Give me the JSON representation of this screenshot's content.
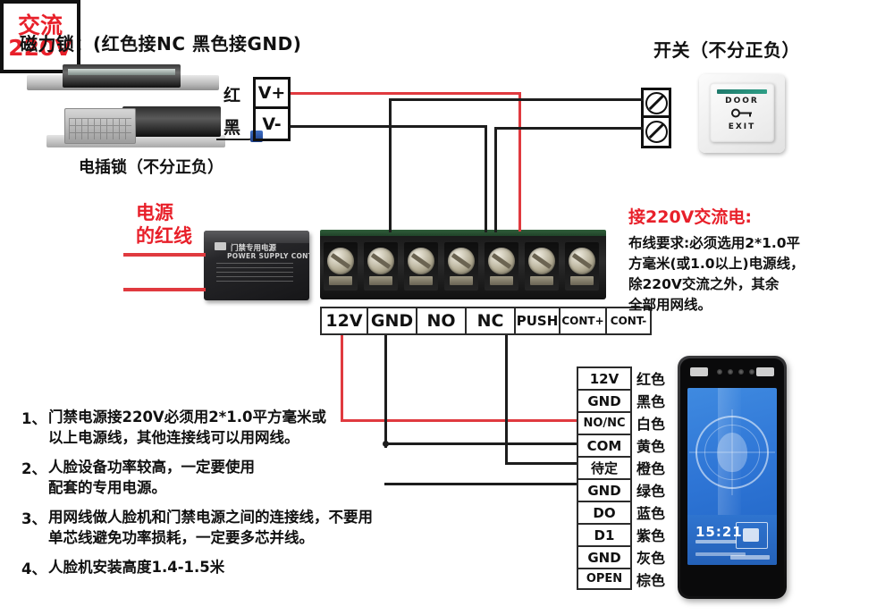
{
  "headings": {
    "mag_lock": "磁力锁：(红色接NC  黑色接GND)",
    "bolt_lock": "电插锁（不分正负）",
    "switch": "开关（不分正负）",
    "power_red_line": "电源\n的红线",
    "ac_label": "交流\n220V"
  },
  "ac_box": {
    "line1": "交流",
    "line2": "220V"
  },
  "psu": {
    "cn": "门禁专用电源",
    "en": "POWER SUPPLY CONTROL"
  },
  "vbox": {
    "red_label": "红",
    "black_label": "黑",
    "vplus": "V+",
    "vminus": "V-"
  },
  "exit_button": {
    "door": "DOOR",
    "exit": "EXIT"
  },
  "terminal_block": {
    "labels": [
      "12V",
      "GND",
      "NO",
      "NC",
      "PUSH",
      "CONT+",
      "CONT-"
    ],
    "widths": [
      52,
      55,
      55,
      55,
      50,
      52,
      52
    ],
    "font_sizes": [
      19,
      19,
      19,
      19,
      15,
      12,
      12
    ]
  },
  "device_terminals": [
    {
      "pin": "12V",
      "color_name": "红色"
    },
    {
      "pin": "GND",
      "color_name": "黑色"
    },
    {
      "pin": "NO/NC",
      "color_name": "白色"
    },
    {
      "pin": "COM",
      "color_name": "黄色"
    },
    {
      "pin": "待定",
      "color_name": "橙色"
    },
    {
      "pin": "GND",
      "color_name": "绿色"
    },
    {
      "pin": "DO",
      "color_name": "蓝色"
    },
    {
      "pin": "D1",
      "color_name": "紫色"
    },
    {
      "pin": "GND",
      "color_name": "灰色"
    },
    {
      "pin": "OPEN",
      "color_name": "棕色"
    }
  ],
  "right_note": {
    "title": "接220V交流电:",
    "lines": [
      "布线要求:必须选用2*1.0平",
      "方毫米(或1.0以上)电源线，",
      "除220V交流之外，其余",
      "全部用网线。"
    ]
  },
  "notes": [
    {
      "num": "1、",
      "lines": [
        "门禁电源接220V必须用2*1.0平方毫米或",
        "以上电源线，其他连接线可以用网线。"
      ]
    },
    {
      "num": "2、",
      "lines": [
        "人脸设备功率较高，一定要使用",
        "配套的专用电源。"
      ]
    },
    {
      "num": "3、",
      "lines": [
        "用网线做人脸机和门禁电源之间的连接线，不要用",
        "单芯线避免功率损耗，一定要多芯并线。"
      ]
    },
    {
      "num": "4、",
      "lines": [
        "人脸机安装高度1.4-1.5米"
      ]
    }
  ],
  "face_device": {
    "time": "15:21"
  },
  "colors": {
    "wire_red": "#e03a3f",
    "wire_black": "#1d1d1d",
    "accent_red": "#e8202a",
    "screen_blue": "#2f76d6",
    "terminal_green": "#2f5e3a"
  }
}
